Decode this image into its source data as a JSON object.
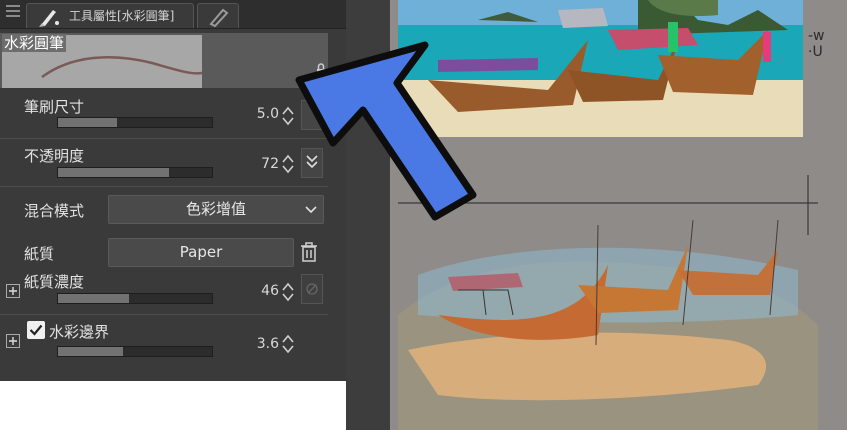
{
  "panel": {
    "tab_title": "工具屬性[水彩圓筆]",
    "brush_name": "水彩圓筆",
    "rows": {
      "brush_size": {
        "label": "筆刷尺寸",
        "value": "5.0",
        "fraction": 0.38
      },
      "opacity": {
        "label": "不透明度",
        "value": "72",
        "fraction": 0.72
      },
      "blend_mode": {
        "label": "混合模式",
        "selected": "色彩增值"
      },
      "paper_texture": {
        "label": "紙質",
        "selected": "Paper"
      },
      "texture_density": {
        "label": "紙質濃度",
        "value": "46",
        "fraction": 0.46
      },
      "watercolor_edge": {
        "label": "水彩邊界",
        "value": "3.6",
        "fraction": 0.42,
        "checked": true
      }
    }
  },
  "canvas": {
    "note_line1": "-w",
    "note_line2": "·U"
  },
  "colors": {
    "panel_bg": "#3a3a3a",
    "canvas_bg": "#8f8b88",
    "arrow_fill": "#4a79e6",
    "arrow_stroke": "#0d0d0d"
  },
  "icons": [
    "menu-icon",
    "brush-tab-icon",
    "ruler-tab-icon",
    "lock-icon",
    "chevron-updown-icon",
    "chevron-down-icon",
    "trash-icon",
    "plus-icon",
    "checkmark-icon",
    "blue-arrow-annotation"
  ]
}
